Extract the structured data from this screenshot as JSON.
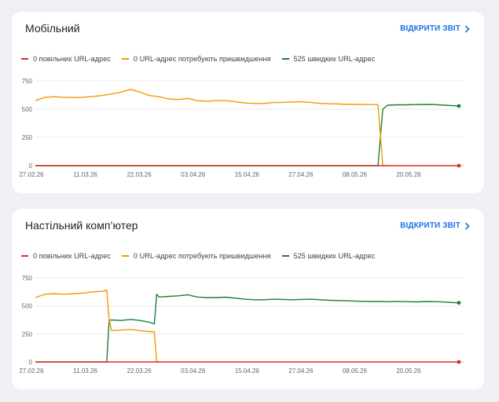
{
  "cards": [
    {
      "title": "Мобільний",
      "open_report": "ВІДКРИТИ ЗВІТ",
      "legend": [
        {
          "label": "0 повільних URL-адрес",
          "color": "#d93025"
        },
        {
          "label": "0 URL-адрес потребують пришвидшення",
          "color": "#f29900"
        },
        {
          "label": "525 швидких URL-адрес",
          "color": "#188038"
        }
      ]
    },
    {
      "title": "Настільний комп’ютер",
      "open_report": "ВІДКРИТИ ЗВІТ",
      "legend": [
        {
          "label": "0 повільних URL-адрес",
          "color": "#d93025"
        },
        {
          "label": "0 URL-адрес потребують пришвидшення",
          "color": "#f29900"
        },
        {
          "label": "525 швидких URL-адрес",
          "color": "#188038"
        }
      ]
    }
  ],
  "chart_data": [
    {
      "type": "line",
      "yticks": [
        750,
        500,
        250,
        0
      ],
      "ylim": [
        0,
        750
      ],
      "x_ticks": [
        "27.02.26",
        "11.03.26",
        "22.03.26",
        "03.04.26",
        "15.04.26",
        "27.04.26",
        "08.05.26",
        "20.05.26"
      ],
      "x_range": [
        0,
        90
      ],
      "series": [
        {
          "name": "0 повільних URL-адрес",
          "color": "#d93025",
          "x": [
            0,
            89
          ],
          "y": [
            0,
            0
          ]
        },
        {
          "name": "0 URL-адрес потребують пришвидшення",
          "color": "#f29900",
          "x": [
            0,
            2,
            4,
            6,
            8,
            10,
            12,
            14,
            16,
            18,
            20,
            22,
            24,
            26,
            28,
            30,
            32,
            34,
            36,
            38,
            40,
            42,
            44,
            46,
            48,
            50,
            52,
            54,
            56,
            58,
            60,
            62,
            64,
            66,
            68,
            70,
            72,
            73,
            74
          ],
          "y": [
            575,
            605,
            610,
            605,
            603,
            605,
            612,
            620,
            635,
            650,
            675,
            650,
            620,
            610,
            590,
            585,
            595,
            575,
            570,
            575,
            575,
            565,
            555,
            550,
            550,
            558,
            560,
            563,
            565,
            558,
            550,
            548,
            545,
            542,
            542,
            540,
            540,
            0,
            0
          ]
        },
        {
          "name": "525 швидких URL-адрес",
          "color": "#188038",
          "x": [
            0,
            72,
            73,
            74,
            76,
            78,
            80,
            82,
            84,
            86,
            88,
            89
          ],
          "y": [
            0,
            0,
            500,
            535,
            538,
            538,
            540,
            542,
            540,
            535,
            530,
            528
          ]
        }
      ]
    },
    {
      "type": "line",
      "yticks": [
        750,
        500,
        250,
        0
      ],
      "ylim": [
        0,
        750
      ],
      "x_ticks": [
        "27.02.26",
        "11.03.26",
        "22.03.26",
        "03.04.26",
        "15.04.26",
        "27.04.26",
        "08.05.26",
        "20.05.26"
      ],
      "x_range": [
        0,
        90
      ],
      "series": [
        {
          "name": "0 повільних URL-адрес",
          "color": "#d93025",
          "x": [
            0,
            89
          ],
          "y": [
            0,
            0
          ]
        },
        {
          "name": "0 URL-адрес потребують пришвидшення",
          "color": "#f29900",
          "x": [
            0,
            2,
            4,
            6,
            8,
            10,
            12,
            14,
            15,
            15.5,
            16,
            18,
            20,
            22,
            24,
            25,
            25.5,
            26
          ],
          "y": [
            575,
            605,
            610,
            605,
            610,
            615,
            625,
            630,
            640,
            380,
            280,
            285,
            290,
            280,
            270,
            270,
            0,
            0
          ]
        },
        {
          "name": "525 швидких URL-адрес",
          "color": "#188038",
          "x": [
            0,
            15,
            15.5,
            16,
            18,
            20,
            22,
            24,
            25,
            25.5,
            26,
            28,
            30,
            32,
            34,
            36,
            38,
            40,
            42,
            44,
            46,
            48,
            50,
            52,
            54,
            56,
            58,
            60,
            62,
            64,
            66,
            68,
            70,
            72,
            74,
            76,
            78,
            80,
            82,
            84,
            86,
            88,
            89
          ],
          "y": [
            0,
            0,
            370,
            375,
            370,
            380,
            370,
            355,
            340,
            605,
            580,
            585,
            590,
            600,
            580,
            575,
            575,
            578,
            570,
            560,
            555,
            555,
            560,
            558,
            555,
            558,
            560,
            555,
            550,
            548,
            545,
            542,
            540,
            540,
            538,
            540,
            538,
            536,
            540,
            538,
            535,
            530,
            528
          ]
        }
      ]
    }
  ]
}
